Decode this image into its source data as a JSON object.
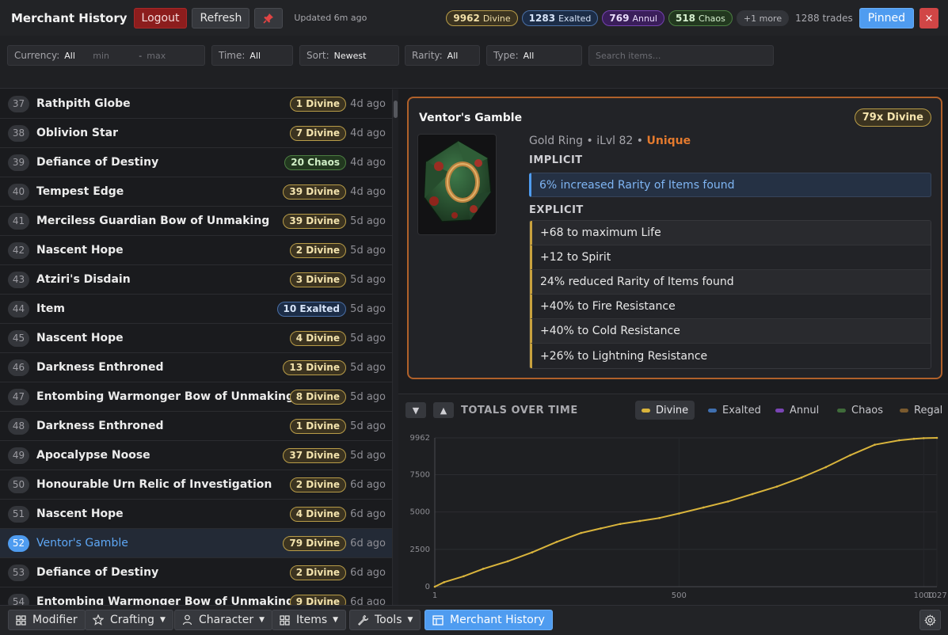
{
  "header": {
    "title": "Merchant History",
    "logout_label": "Logout",
    "refresh_label": "Refresh",
    "updated": "Updated 6m ago",
    "currencies": [
      {
        "amount": "9962",
        "name": "Divine",
        "kind": "divine"
      },
      {
        "amount": "1283",
        "name": "Exalted",
        "kind": "exalted"
      },
      {
        "amount": "769",
        "name": "Annul",
        "kind": "annul"
      },
      {
        "amount": "518",
        "name": "Chaos",
        "kind": "chaos"
      }
    ],
    "more_label": "+1 more",
    "trades_label": "1288 trades",
    "pinned_label": "Pinned",
    "close_label": "×"
  },
  "filters": {
    "currency_label": "Currency:",
    "currency_value": "All",
    "min_placeholder": "min",
    "dash": "-",
    "max_placeholder": "max",
    "time_label": "Time:",
    "time_value": "All",
    "sort_label": "Sort:",
    "sort_value": "Newest",
    "rarity_label": "Rarity:",
    "rarity_value": "All",
    "type_label": "Type:",
    "type_value": "All",
    "search_placeholder": "Search items..."
  },
  "list": [
    {
      "num": "37",
      "name": "Rathpith Globe",
      "price": "1 Divine",
      "kind": "divine",
      "time": "4d ago"
    },
    {
      "num": "38",
      "name": "Oblivion Star",
      "price": "7 Divine",
      "kind": "divine",
      "time": "4d ago"
    },
    {
      "num": "39",
      "name": "Defiance of Destiny",
      "price": "20 Chaos",
      "kind": "chaos",
      "time": "4d ago"
    },
    {
      "num": "40",
      "name": "Tempest Edge",
      "price": "39 Divine",
      "kind": "divine",
      "time": "4d ago"
    },
    {
      "num": "41",
      "name": "Merciless Guardian Bow of Unmaking",
      "price": "39 Divine",
      "kind": "divine",
      "time": "5d ago"
    },
    {
      "num": "42",
      "name": "Nascent Hope",
      "price": "2 Divine",
      "kind": "divine",
      "time": "5d ago"
    },
    {
      "num": "43",
      "name": "Atziri's Disdain",
      "price": "3 Divine",
      "kind": "divine",
      "time": "5d ago"
    },
    {
      "num": "44",
      "name": "Item",
      "price": "10 Exalted",
      "kind": "exalted",
      "time": "5d ago"
    },
    {
      "num": "45",
      "name": "Nascent Hope",
      "price": "4 Divine",
      "kind": "divine",
      "time": "5d ago"
    },
    {
      "num": "46",
      "name": "Darkness Enthroned",
      "price": "13 Divine",
      "kind": "divine",
      "time": "5d ago"
    },
    {
      "num": "47",
      "name": "Entombing Warmonger Bow of Unmaking",
      "price": "8 Divine",
      "kind": "divine",
      "time": "5d ago"
    },
    {
      "num": "48",
      "name": "Darkness Enthroned",
      "price": "1 Divine",
      "kind": "divine",
      "time": "5d ago"
    },
    {
      "num": "49",
      "name": "Apocalypse Noose",
      "price": "37 Divine",
      "kind": "divine",
      "time": "5d ago"
    },
    {
      "num": "50",
      "name": "Honourable Urn Relic of Investigation",
      "price": "2 Divine",
      "kind": "divine",
      "time": "6d ago"
    },
    {
      "num": "51",
      "name": "Nascent Hope",
      "price": "4 Divine",
      "kind": "divine",
      "time": "6d ago"
    },
    {
      "num": "52",
      "name": "Ventor's Gamble",
      "price": "79 Divine",
      "kind": "divine",
      "time": "6d ago",
      "selected": true
    },
    {
      "num": "53",
      "name": "Defiance of Destiny",
      "price": "2 Divine",
      "kind": "divine",
      "time": "6d ago"
    },
    {
      "num": "54",
      "name": "Entombing Warmonger Bow of Unmaking",
      "price": "9 Divine",
      "kind": "divine",
      "time": "6d ago"
    }
  ],
  "detail": {
    "title": "Ventor's Gamble",
    "price": "79x Divine",
    "base": "Gold Ring",
    "sep1": "•",
    "ilvl": "iLvl 82",
    "sep2": "•",
    "rarity": "Unique",
    "implicit_label": "IMPLICIT",
    "implicit": "6% increased Rarity of Items found",
    "explicit_label": "EXPLICIT",
    "explicit": [
      "+68 to maximum Life",
      "+12 to Spirit",
      "24% reduced Rarity of Items found",
      "+40% to Fire Resistance",
      "+40% to Cold Resistance",
      "+26% to Lightning Resistance"
    ]
  },
  "chart_panel": {
    "collapse_label": "▼",
    "expand_label": "▲",
    "title": "TOTALS OVER TIME",
    "legend": [
      {
        "name": "Divine",
        "color": "#d9b43c",
        "active": true
      },
      {
        "name": "Exalted",
        "color": "#3f6fb0",
        "active": false
      },
      {
        "name": "Annul",
        "color": "#7a45b5",
        "active": false
      },
      {
        "name": "Chaos",
        "color": "#3f6b3a",
        "active": false
      },
      {
        "name": "Regal",
        "color": "#7a5a2e",
        "active": false
      }
    ]
  },
  "chart_data": {
    "type": "line",
    "title": "TOTALS OVER TIME",
    "xlabel": "",
    "ylabel": "",
    "xlim": [
      1,
      1027
    ],
    "ylim": [
      0,
      9962
    ],
    "x_ticks": [
      1,
      500,
      1000,
      1027
    ],
    "y_ticks": [
      0,
      2500,
      5000,
      7500,
      9962
    ],
    "grid": true,
    "series": [
      {
        "name": "Divine",
        "color": "#d9b43c",
        "x": [
          1,
          20,
          60,
          100,
          150,
          200,
          250,
          300,
          340,
          380,
          420,
          460,
          500,
          550,
          600,
          650,
          700,
          750,
          800,
          850,
          900,
          950,
          980,
          1000,
          1027
        ],
        "y": [
          0,
          300,
          700,
          1200,
          1700,
          2300,
          3000,
          3600,
          3900,
          4200,
          4400,
          4600,
          4900,
          5300,
          5700,
          6200,
          6700,
          7300,
          8000,
          8800,
          9500,
          9800,
          9900,
          9940,
          9962
        ]
      }
    ]
  },
  "bottom_bar": {
    "modifier": "Modifier",
    "crafting": "Crafting",
    "character": "Character",
    "items": "Items",
    "tools": "Tools",
    "merchant": "Merchant History"
  }
}
